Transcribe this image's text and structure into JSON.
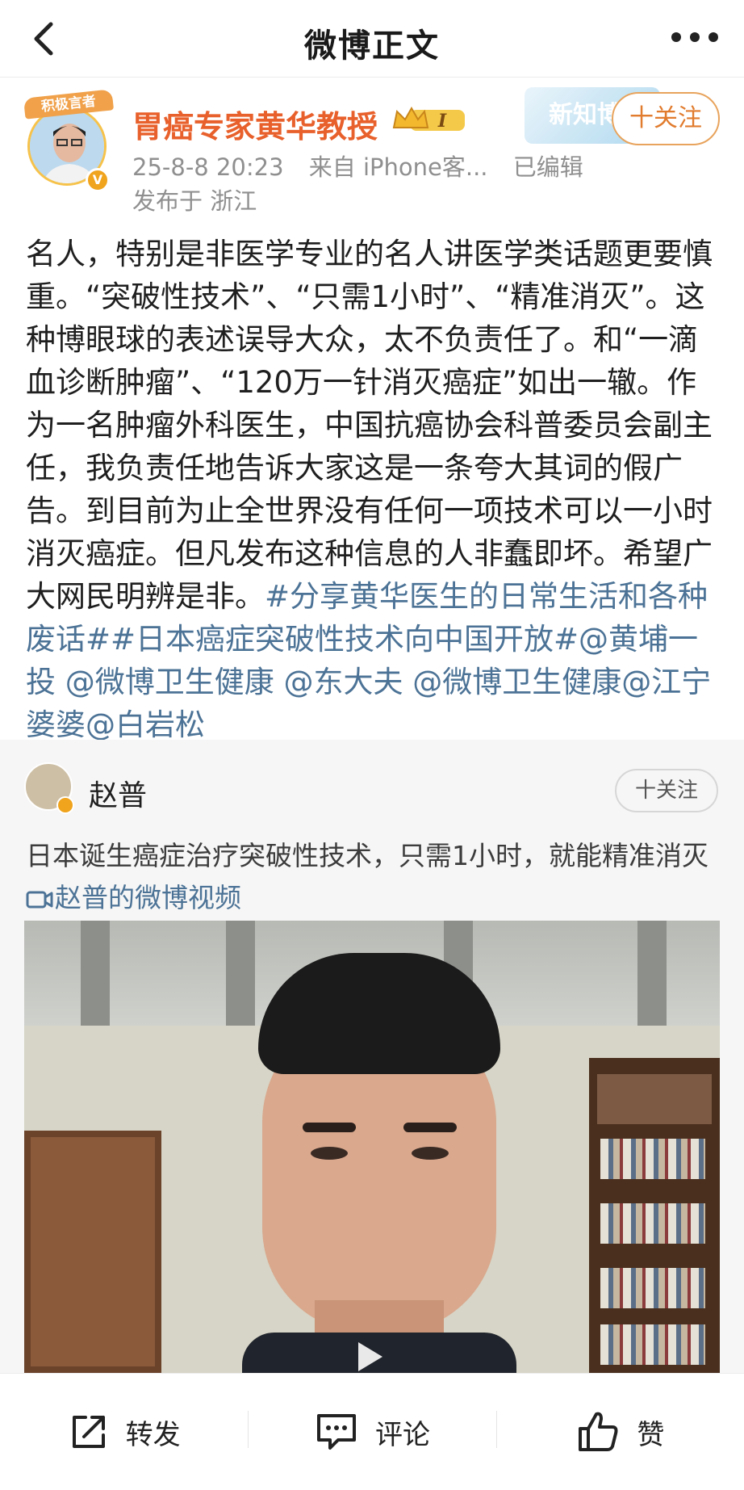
{
  "header": {
    "title": "微博正文",
    "back_icon": "chevron-left-icon",
    "more_icon": "more-horizontal-icon"
  },
  "author": {
    "avatar_banner": "积极言者",
    "name": "胃癌专家黄华教授",
    "vip_level": "I",
    "date": "25-8-8 20:23",
    "source": "来自 iPhone客...",
    "edited": "已编辑",
    "location": "发布于 浙江",
    "follow_label": "十关注",
    "background_badge": "新知博"
  },
  "post": {
    "text": "名人，特别是非医学专业的名人讲医学类话题更要慎重。“突破性技术”、“只需1小时”、“精准消灭”。这种博眼球的表述误导大众，太不负责任了。和“一滴血诊断肿瘤”、“120万一针消灭癌症”如出一辙。作为一名肿瘤外科医生，中国抗癌协会科普委员会副主任，我负责任地告诉大家这是一条夸大其词的假广告。到目前为止全世界没有任何一项技术可以一小时消灭癌症。但凡发布这种信息的人非蠢即坏。希望广大网民明辨是非。",
    "topics": "#分享黄华医生的日常生活和各种废话##日本癌症突破性技术向中国开放#@黄埔一投 @微博卫生健康 @东大夫 @微博卫生健康@江宁婆婆@白岩松"
  },
  "repost": {
    "name": "赵普",
    "follow_label": "十关注",
    "text": "日本诞生癌症治疗突破性技术，只需1小时，就能精准消灭 ",
    "video_link": "赵普的微博视频"
  },
  "actions": {
    "share_label": "转发",
    "comment_label": "评论",
    "like_label": "赞"
  },
  "colors": {
    "author_name": "#e8602b",
    "link": "#4c7396",
    "meta": "#8f8f8f",
    "repost_bg": "#f6f6f6"
  }
}
